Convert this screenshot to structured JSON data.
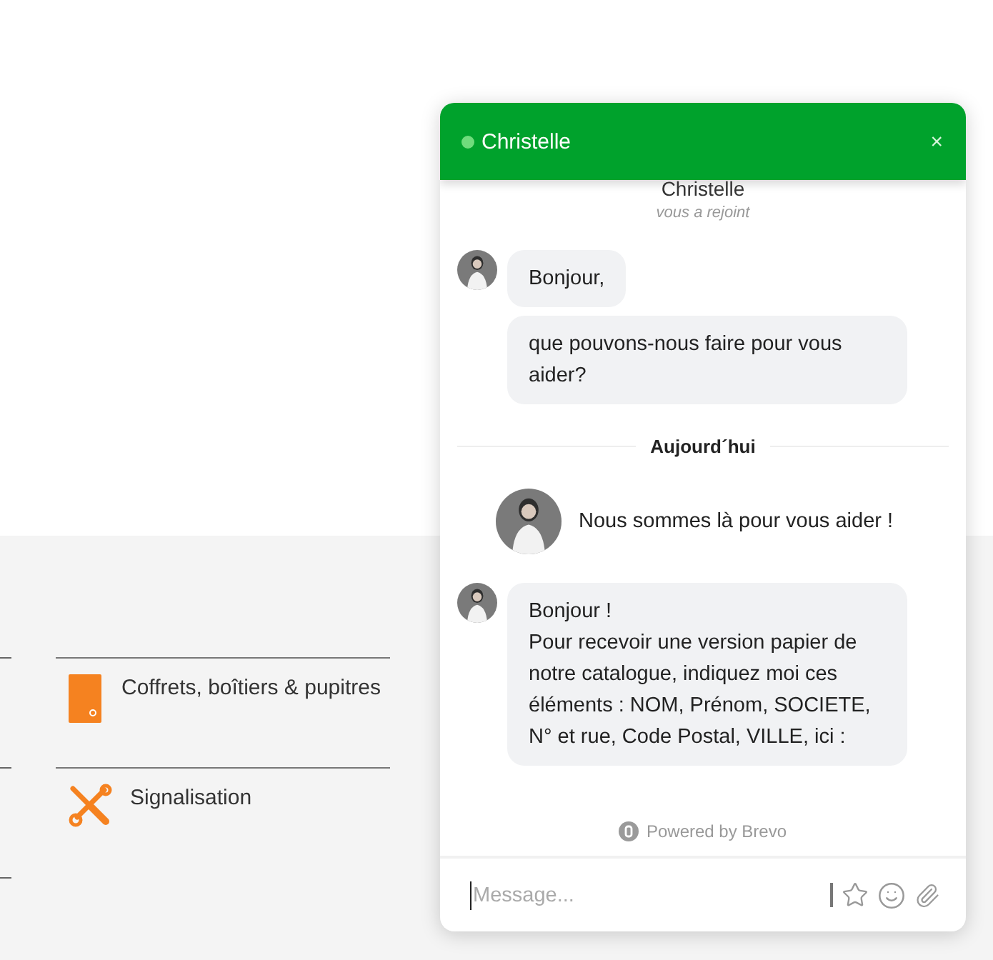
{
  "page": {
    "categories": [
      {
        "label": "Coffrets, boîtiers & pupitres",
        "kind": "cabinet"
      },
      {
        "label": "Signalisation",
        "kind": "tools"
      }
    ]
  },
  "chat": {
    "header": {
      "agent": "Christelle",
      "online": true,
      "close": "×"
    },
    "join": {
      "name": "Christelle",
      "note": "vous a rejoint"
    },
    "messages": [
      {
        "kind": "bubbles",
        "texts": [
          "Bonjour,",
          "que pouvons-nous faire pour vous aider?"
        ]
      },
      {
        "kind": "divider",
        "text": "Aujourd´hui"
      },
      {
        "kind": "intro",
        "text": "Nous sommes là pour vous aider !"
      },
      {
        "kind": "bubbles",
        "texts": [
          "Bonjour !\nPour recevoir une version papier de notre catalogue, indiquez moi ces éléments : NOM, Prénom, SOCIETE, N° et rue, Code Postal, VILLE, ici :"
        ]
      }
    ],
    "powered": "Powered by Brevo",
    "input": {
      "placeholder": "Message..."
    }
  }
}
